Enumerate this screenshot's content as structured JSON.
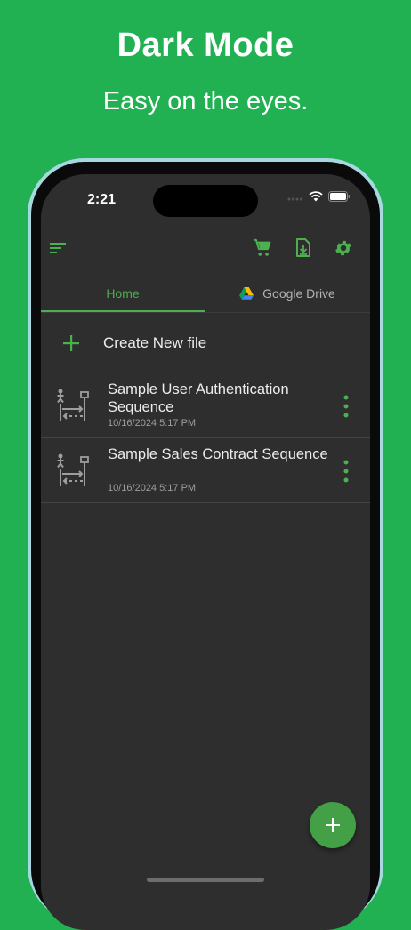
{
  "promo": {
    "headline": "Dark Mode",
    "tagline": "Easy on the eyes."
  },
  "status_bar": {
    "time": "2:21"
  },
  "app_bar": {
    "icons": [
      "sort-icon",
      "cart-icon",
      "file-download-icon",
      "gear-icon"
    ],
    "accent": "#4caf50"
  },
  "tabs": [
    {
      "label": "Home",
      "selected": true
    },
    {
      "label": "Google Drive",
      "selected": false
    }
  ],
  "create": {
    "label": "Create New file"
  },
  "files": [
    {
      "title": "Sample User Authentication Sequence",
      "date": "10/16/2024 5:17 PM"
    },
    {
      "title": "Sample Sales Contract Sequence",
      "date": "10/16/2024 5:17 PM"
    }
  ],
  "colors": {
    "background": "#21b153",
    "screen": "#2e2e2e",
    "accent": "#4caf50",
    "text": "#ececec",
    "subtext": "#9e9e9e"
  }
}
